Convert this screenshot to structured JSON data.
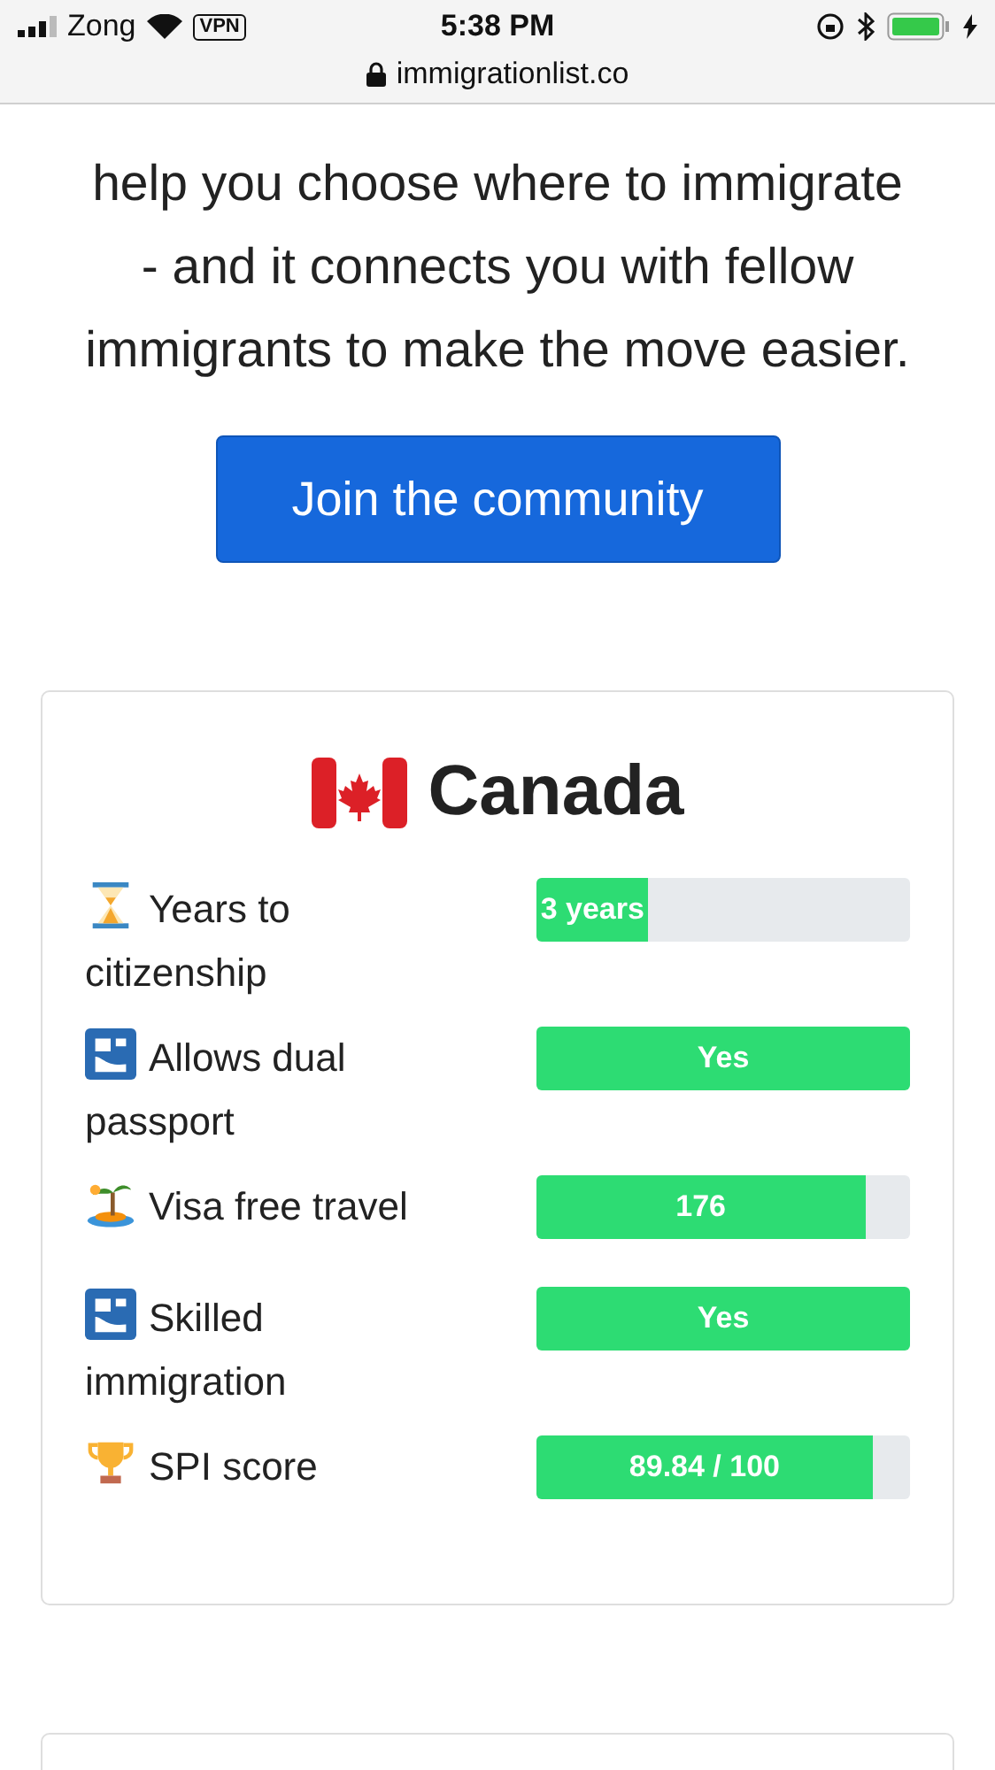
{
  "status_bar": {
    "carrier": "Zong",
    "vpn": "VPN",
    "time": "5:38 PM",
    "url": "immigrationlist.co"
  },
  "intro": {
    "lines": [
      "help you choose where to immigrate",
      "- and it connects you with fellow",
      "immigrants to make the move easier."
    ]
  },
  "cta_button": "Join the community",
  "country_card": {
    "title": "Canada",
    "rows": [
      {
        "kind": "hourglass",
        "label": "Years to citizenship",
        "value": "3 years",
        "level": 0.3
      },
      {
        "kind": "passport",
        "label": "Allows dual passport",
        "value": "Yes",
        "level": 1
      },
      {
        "kind": "island",
        "label": "Visa free travel",
        "value": "176",
        "level": 0.88
      },
      {
        "kind": "passport",
        "label": "Skilled immigration",
        "value": "Yes",
        "level": 1
      },
      {
        "kind": "trophy",
        "label": "SPI score",
        "value": "89.84 / 100",
        "level": 0.9
      }
    ]
  }
}
